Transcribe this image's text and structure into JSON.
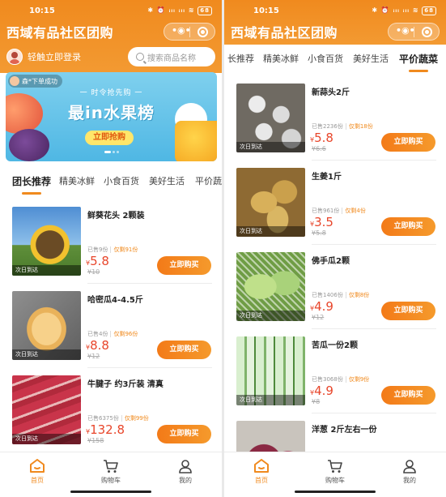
{
  "app_title": "西域有品社区团购",
  "status": {
    "time": "10:15",
    "icons": "✱ ⏰ ᵢₗₗ ᵢₗₗ ≋",
    "battery": "68"
  },
  "left": {
    "login_text": "轻触立即登录",
    "search_placeholder": "搜索商品名称",
    "banner": {
      "toast": "森*下单成功",
      "subtitle": "一 时令抢先购 一",
      "headline": "最in水果榜",
      "button": "立即抢购"
    },
    "tabs": [
      "团长推荐",
      "精美冰鲜",
      "小食百货",
      "美好生活",
      "平价蔬"
    ],
    "items": [
      {
        "name": "鲜葵花头 2颗装",
        "sold": "已售9份",
        "remain": "仅剩91份",
        "currency": "¥",
        "price": "5.8",
        "orig": "¥10",
        "badge": "次日到达",
        "image": "sunflower",
        "button": "立即购买"
      },
      {
        "name": "哈密瓜4-4.5斤",
        "sold": "已售4份",
        "remain": "仅剩96份",
        "currency": "¥",
        "price": "8.8",
        "orig": "¥12",
        "badge": "次日到达",
        "image": "melon",
        "button": "立即购买"
      },
      {
        "name": "牛腱子 约3斤装 清真",
        "sold": "已售6375份",
        "remain": "仅剩99份",
        "currency": "¥",
        "price": "132.8",
        "orig": "¥158",
        "badge": "次日到达",
        "image": "beef",
        "button": "立即购买"
      }
    ]
  },
  "right": {
    "tabs": [
      "长推荐",
      "精美冰鲜",
      "小食百货",
      "美好生活",
      "平价蔬菜"
    ],
    "items": [
      {
        "name": "新蒜头2斤",
        "sold": "已售2236份",
        "remain": "仅剩18份",
        "currency": "¥",
        "price": "5.8",
        "orig": "¥6.6",
        "badge": "次日到达",
        "image": "garlic",
        "button": "立即购买"
      },
      {
        "name": "生姜1斤",
        "sold": "已售961份",
        "remain": "仅剩4份",
        "currency": "¥",
        "price": "3.5",
        "orig": "¥5.8",
        "badge": "次日到达",
        "image": "ginger",
        "button": "立即购买"
      },
      {
        "name": "佛手瓜2颗",
        "sold": "已售1406份",
        "remain": "仅剩8份",
        "currency": "¥",
        "price": "4.9",
        "orig": "¥12",
        "badge": "次日到达",
        "image": "chayote",
        "button": "立即购买"
      },
      {
        "name": "苦瓜一份2颗",
        "sold": "已售3068份",
        "remain": "仅剩9份",
        "currency": "¥",
        "price": "4.9",
        "orig": "¥8",
        "badge": "次日到达",
        "image": "bitter",
        "button": "立即购买"
      },
      {
        "name": "洋葱 2斤左右一份",
        "sold": "",
        "remain": "",
        "currency": "",
        "price": "",
        "orig": "",
        "badge": "",
        "image": "onion",
        "button": ""
      }
    ]
  },
  "nav": {
    "home": "首页",
    "cart": "购物车",
    "mine": "我的"
  },
  "colors": {
    "brand": "#f08a1e",
    "price": "#e8462b"
  }
}
